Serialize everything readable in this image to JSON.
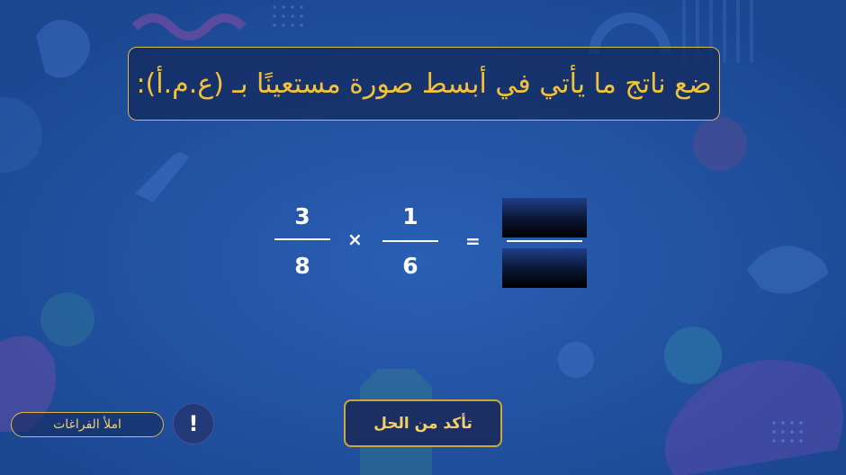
{
  "question": {
    "text": "ضع ناتج ما يأتي في أبسط صورة مستعينًا بـ (ع.م.أ):"
  },
  "equation": {
    "fraction1": {
      "numerator": "3",
      "denominator": "8"
    },
    "operator": "×",
    "fraction2": {
      "numerator": "1",
      "denominator": "6"
    },
    "equals": "=",
    "answer": {
      "numerator": "",
      "denominator": ""
    }
  },
  "hint": {
    "label": "املأ الفراغات",
    "icon": "exclamation-icon",
    "icon_glyph": "!"
  },
  "check_button": {
    "label": "تأكد من الحل"
  },
  "colors": {
    "background": "#1f4f9c",
    "accent": "#f2c23a",
    "border": "#d8b94a"
  }
}
